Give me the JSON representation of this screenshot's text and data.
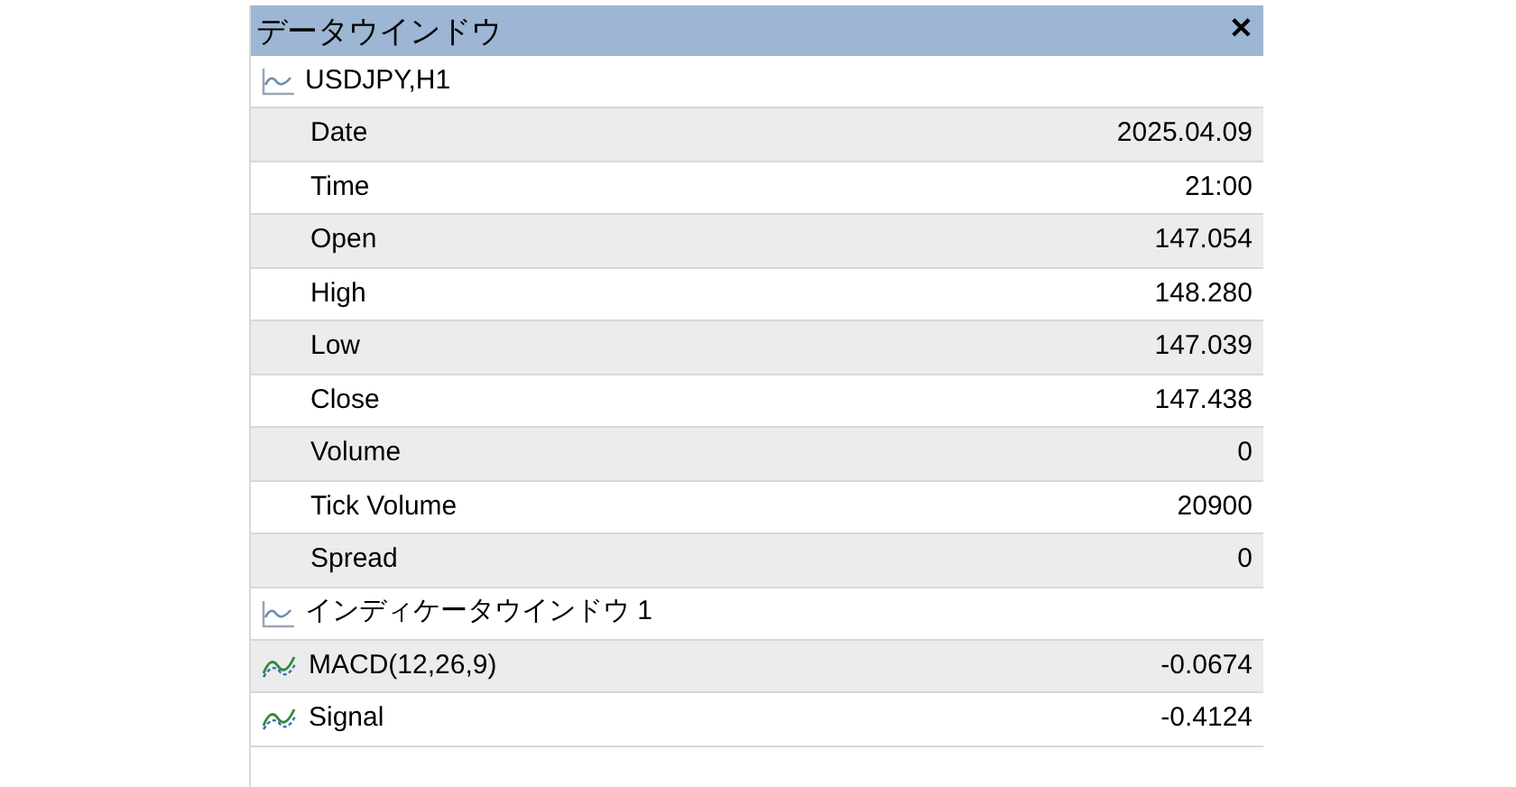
{
  "window": {
    "title": "データウインドウ",
    "close": "✕"
  },
  "sections": [
    {
      "title": "USDJPY,H1",
      "rows": [
        {
          "label": "Date",
          "value": "2025.04.09"
        },
        {
          "label": "Time",
          "value": "21:00"
        },
        {
          "label": "Open",
          "value": "147.054"
        },
        {
          "label": "High",
          "value": "148.280"
        },
        {
          "label": "Low",
          "value": "147.039"
        },
        {
          "label": "Close",
          "value": "147.438"
        },
        {
          "label": "Volume",
          "value": "0"
        },
        {
          "label": "Tick Volume",
          "value": "20900"
        },
        {
          "label": "Spread",
          "value": "0"
        }
      ]
    },
    {
      "title": "インディケータウインドウ 1",
      "rows": [
        {
          "label": "MACD(12,26,9)",
          "value": "-0.0674",
          "kind": "indicator"
        },
        {
          "label": "Signal",
          "value": "-0.4124",
          "kind": "indicator"
        }
      ]
    }
  ]
}
